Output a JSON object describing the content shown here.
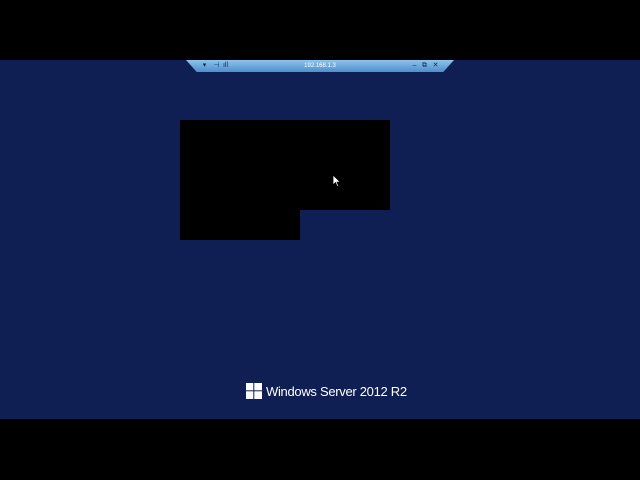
{
  "rdp_bar": {
    "title": "192.168.1.3",
    "pin_icon": "pin-icon",
    "signal_icon": "signal-icon",
    "minimize_label": "–",
    "restore_label": "⧉",
    "close_label": "✕"
  },
  "brand": {
    "text": "Windows Server 2012 R2",
    "logo_icon": "windows-logo-icon"
  },
  "colors": {
    "desktop_background": "#0f1f54",
    "letterbox": "#000000",
    "rdp_bar": "#6aa7dc"
  }
}
